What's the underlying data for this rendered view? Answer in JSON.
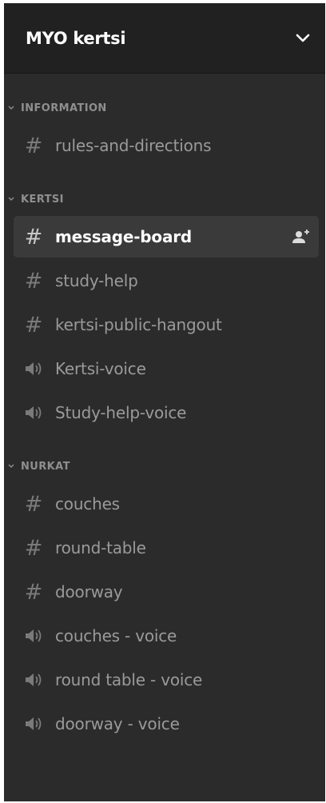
{
  "server": {
    "name": "MYO kertsi"
  },
  "categories": [
    {
      "label": "INFORMATION",
      "channels": [
        {
          "label": "rules-and-directions",
          "type": "text",
          "icon": "hash-icon"
        }
      ]
    },
    {
      "label": "KERTSI",
      "channels": [
        {
          "label": "message-board",
          "type": "text",
          "icon": "hash-icon",
          "active": true
        },
        {
          "label": "study-help",
          "type": "text",
          "icon": "hash-icon"
        },
        {
          "label": "kertsi-public-hangout",
          "type": "text",
          "icon": "hash-icon"
        },
        {
          "label": "Kertsi-voice",
          "type": "voice",
          "icon": "speaker-icon"
        },
        {
          "label": "Study-help-voice",
          "type": "voice",
          "icon": "speaker-icon"
        }
      ]
    },
    {
      "label": "NURKAT",
      "channels": [
        {
          "label": "couches",
          "type": "text",
          "icon": "hash-icon"
        },
        {
          "label": "round-table",
          "type": "text",
          "icon": "hash-icon"
        },
        {
          "label": "doorway",
          "type": "text",
          "icon": "hash-icon"
        },
        {
          "label": "couches - voice",
          "type": "voice",
          "icon": "speaker-icon"
        },
        {
          "label": "round table - voice",
          "type": "voice",
          "icon": "speaker-icon"
        },
        {
          "label": "doorway - voice",
          "type": "voice",
          "icon": "speaker-icon"
        }
      ]
    }
  ],
  "colors": {
    "sidebar_bg": "#2b2b2b",
    "header_bg": "#212121",
    "active_bg": "#3a3a3a",
    "text_muted": "#9a9a9a",
    "text_active": "#ffffff"
  }
}
